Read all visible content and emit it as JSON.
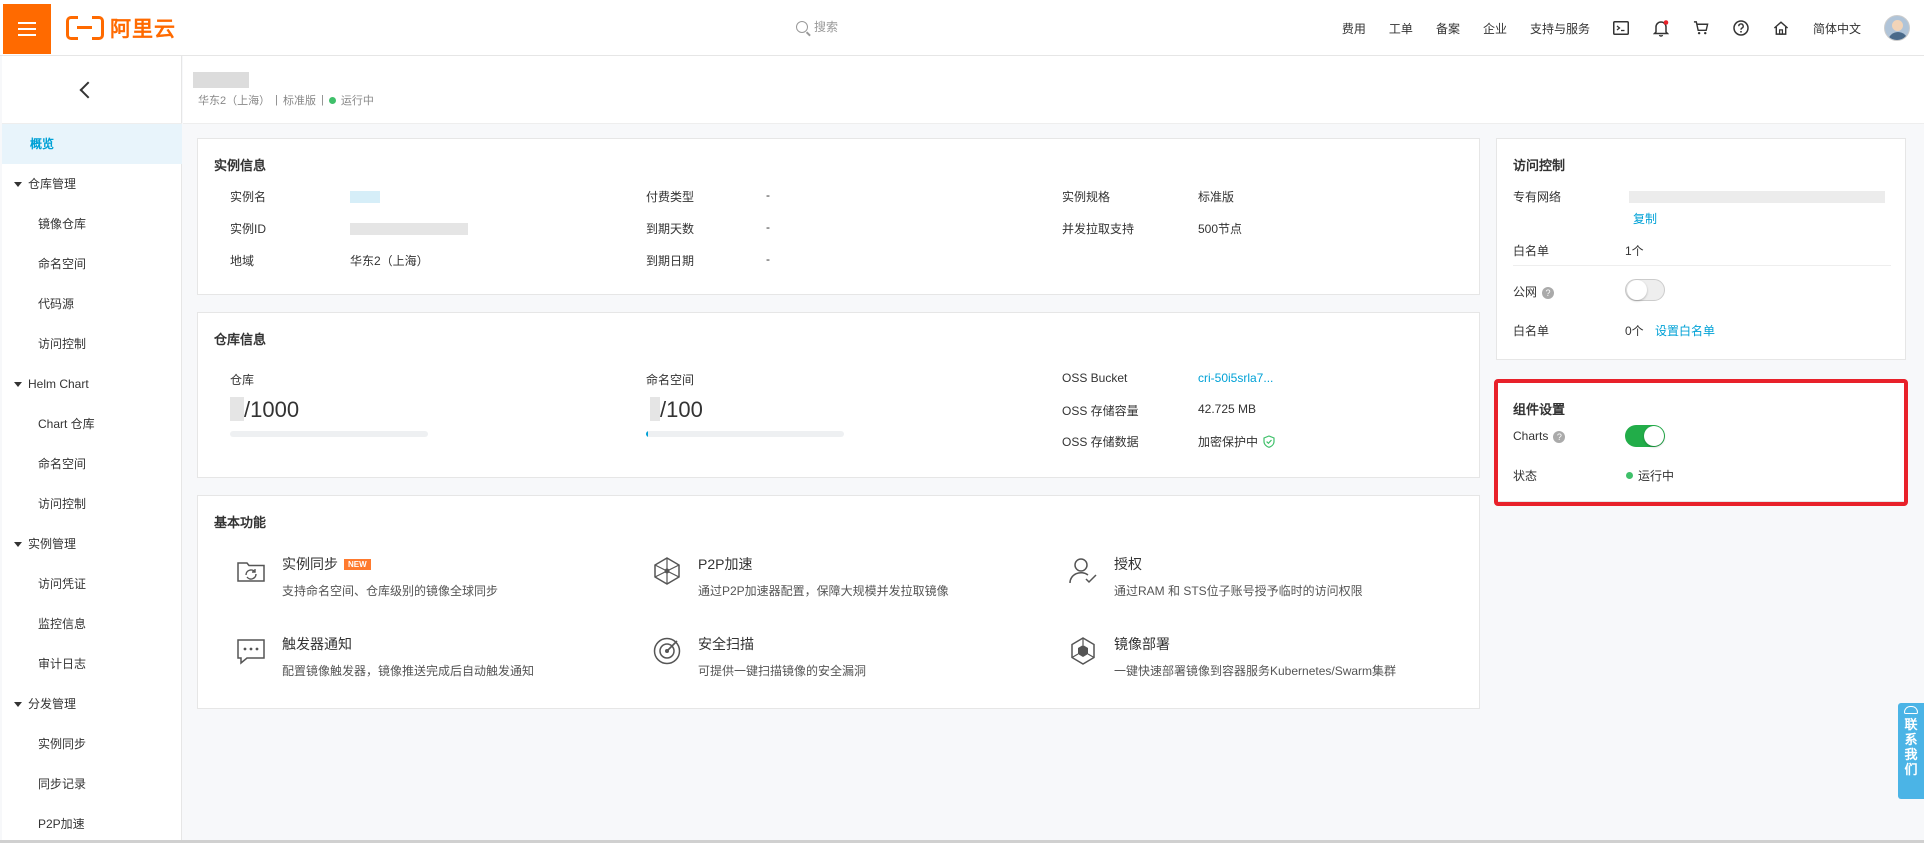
{
  "topbar": {
    "brand": "阿里云",
    "search_placeholder": "搜索",
    "nav": [
      "费用",
      "工单",
      "备案",
      "企业",
      "支持与服务"
    ],
    "icons": [
      "terminal-icon",
      "bell-icon",
      "cart-icon",
      "help-icon",
      "home-icon"
    ],
    "language": "简体中文"
  },
  "sidebar": {
    "items": [
      {
        "label": "概览",
        "kind": "active"
      },
      {
        "label": "仓库管理",
        "kind": "group"
      },
      {
        "label": "镜像仓库",
        "kind": "sub"
      },
      {
        "label": "命名空间",
        "kind": "sub"
      },
      {
        "label": "代码源",
        "kind": "sub"
      },
      {
        "label": "访问控制",
        "kind": "sub"
      },
      {
        "label": "Helm Chart",
        "kind": "group"
      },
      {
        "label": "Chart 仓库",
        "kind": "sub"
      },
      {
        "label": "命名空间",
        "kind": "sub"
      },
      {
        "label": "访问控制",
        "kind": "sub"
      },
      {
        "label": "实例管理",
        "kind": "group"
      },
      {
        "label": "访问凭证",
        "kind": "sub"
      },
      {
        "label": "监控信息",
        "kind": "sub"
      },
      {
        "label": "审计日志",
        "kind": "sub"
      },
      {
        "label": "分发管理",
        "kind": "group"
      },
      {
        "label": "实例同步",
        "kind": "sub"
      },
      {
        "label": "同步记录",
        "kind": "sub"
      },
      {
        "label": "P2P加速",
        "kind": "sub"
      }
    ]
  },
  "header": {
    "region": "华东2（上海）",
    "sep1": "|",
    "edition": "标准版",
    "sep2": "|",
    "status": "运行中"
  },
  "instance": {
    "title": "实例信息",
    "name_label": "实例名",
    "id_label": "实例ID",
    "region_label": "地域",
    "region_value": "华东2（上海）",
    "pay_label": "付费类型",
    "pay_value": "-",
    "days_label": "到期天数",
    "days_value": "-",
    "date_label": "到期日期",
    "date_value": "-",
    "spec_label": "实例规格",
    "spec_value": "标准版",
    "pull_label": "并发拉取支持",
    "pull_value": "500节点"
  },
  "repo": {
    "title": "仓库信息",
    "repo_label": "仓库",
    "repo_quota": "/1000",
    "repo_fill": 0.0,
    "ns_label": "命名空间",
    "ns_quota": "/100",
    "ns_fill": 0.01,
    "oss_bucket_label": "OSS Bucket",
    "oss_bucket_value": "cri-50i5srla7...",
    "oss_cap_label": "OSS 存储容量",
    "oss_cap_value": "42.725 MB",
    "oss_data_label": "OSS 存储数据",
    "oss_data_value": "加密保护中"
  },
  "features": {
    "title": "基本功能",
    "new_badge": "NEW",
    "items": [
      {
        "title": "实例同步",
        "desc": "支持命名空间、仓库级别的镜像全球同步",
        "icon": "sync-icon"
      },
      {
        "title": "P2P加速",
        "desc": "通过P2P加速器配置，保障大规模并发拉取镜像",
        "icon": "p2p-icon"
      },
      {
        "title": "授权",
        "desc": "通过RAM 和 STS位子账号授予临时的访问权限",
        "icon": "user-auth-icon"
      },
      {
        "title": "触发器通知",
        "desc": "配置镜像触发器，镜像推送完成后自动触发通知",
        "icon": "message-icon"
      },
      {
        "title": "安全扫描",
        "desc": "可提供一键扫描镜像的安全漏洞",
        "icon": "scan-icon"
      },
      {
        "title": "镜像部署",
        "desc": "一键快速部署镜像到容器服务Kubernetes/Swarm集群",
        "icon": "deploy-icon"
      }
    ]
  },
  "access": {
    "title": "访问控制",
    "vpc_label": "专有网络",
    "copy_label": "复制",
    "whitelist_label": "白名单",
    "whitelist_count": "1个",
    "public_label": "公网",
    "public_enabled": false,
    "whitelist2_label": "白名单",
    "whitelist2_count": "0个",
    "set_whitelist": "设置白名单"
  },
  "components": {
    "title": "组件设置",
    "charts_label": "Charts",
    "charts_enabled": true,
    "status_label": "状态",
    "status_value": "运行中"
  },
  "contact": {
    "label": "联系我们"
  },
  "colors": {
    "brand": "#ff6a00",
    "link": "#00a1d6",
    "success": "#3fc06a",
    "toggle_on": "#22ad49",
    "highlight": "#e8212a"
  }
}
